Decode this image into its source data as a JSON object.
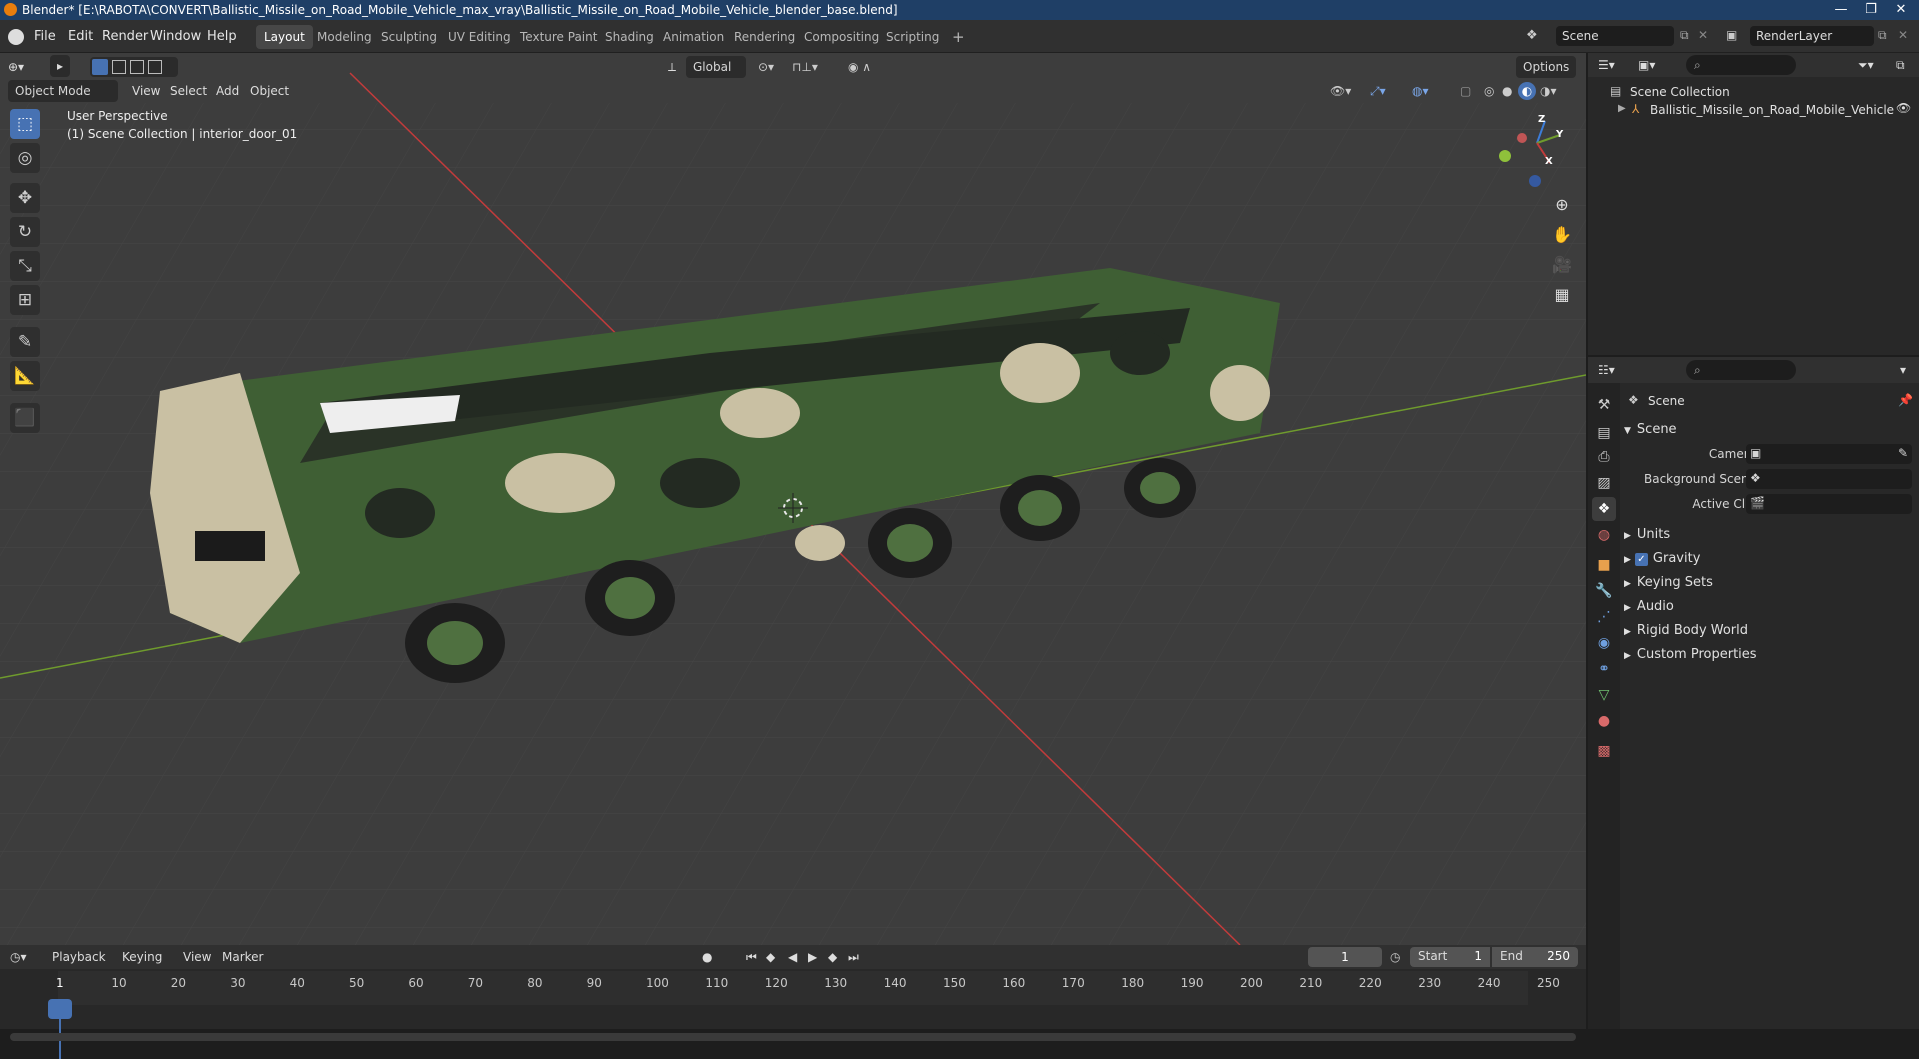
{
  "window": {
    "title": "Blender* [E:\\RABOTA\\CONVERT\\Ballistic_Missile_on_Road_Mobile_Vehicle_max_vray\\Ballistic_Missile_on_Road_Mobile_Vehicle_blender_base.blend]",
    "minimize": "—",
    "maximize": "❐",
    "close": "✕"
  },
  "menu": [
    "File",
    "Edit",
    "Render",
    "Window",
    "Help"
  ],
  "workspaces": [
    "Layout",
    "Modeling",
    "Sculpting",
    "UV Editing",
    "Texture Paint",
    "Shading",
    "Animation",
    "Rendering",
    "Compositing",
    "Scripting",
    "+"
  ],
  "scene_field": "Scene",
  "renderlayer_field": "RenderLayer",
  "viewport": {
    "mode": "Object Mode",
    "header_menus": [
      "View",
      "Select",
      "Add",
      "Object"
    ],
    "transform_orientation": "Global",
    "options_label": "Options",
    "overlay_title": "User Perspective",
    "overlay_sub": "(1) Scene Collection | interior_door_01",
    "gizmo": {
      "x": "X",
      "y": "Y",
      "z": "Z"
    }
  },
  "outliner": {
    "root": "Scene Collection",
    "items": [
      "Ballistic_Missile_on_Road_Mobile_Vehicle"
    ]
  },
  "properties": {
    "header": "Scene",
    "section": "Scene",
    "fields": [
      "Camera",
      "Background Scene",
      "Active Clip"
    ],
    "panels": [
      "Units",
      "Gravity",
      "Keying Sets",
      "Audio",
      "Rigid Body World",
      "Custom Properties"
    ],
    "gravity_checked": true
  },
  "timeline": {
    "menus": [
      "Playback",
      "Keying",
      "View",
      "Marker"
    ],
    "current_frame": "1",
    "start_label": "Start",
    "start": "1",
    "end_label": "End",
    "end": "250",
    "ticks": [
      "1",
      "10",
      "20",
      "30",
      "40",
      "50",
      "60",
      "70",
      "80",
      "90",
      "100",
      "110",
      "120",
      "130",
      "140",
      "150",
      "160",
      "170",
      "180",
      "190",
      "200",
      "210",
      "220",
      "230",
      "240",
      "250"
    ]
  },
  "colors": {
    "accent": "#4772b3",
    "viewport_bg": "#3d3d3d",
    "panel_bg": "#282828",
    "x_axis": "#c23b3b",
    "y_axis": "#6f9b2d",
    "camo_green": "#3f5f34",
    "camo_dark": "#232a22",
    "camo_sand": "#c9c0a3"
  }
}
